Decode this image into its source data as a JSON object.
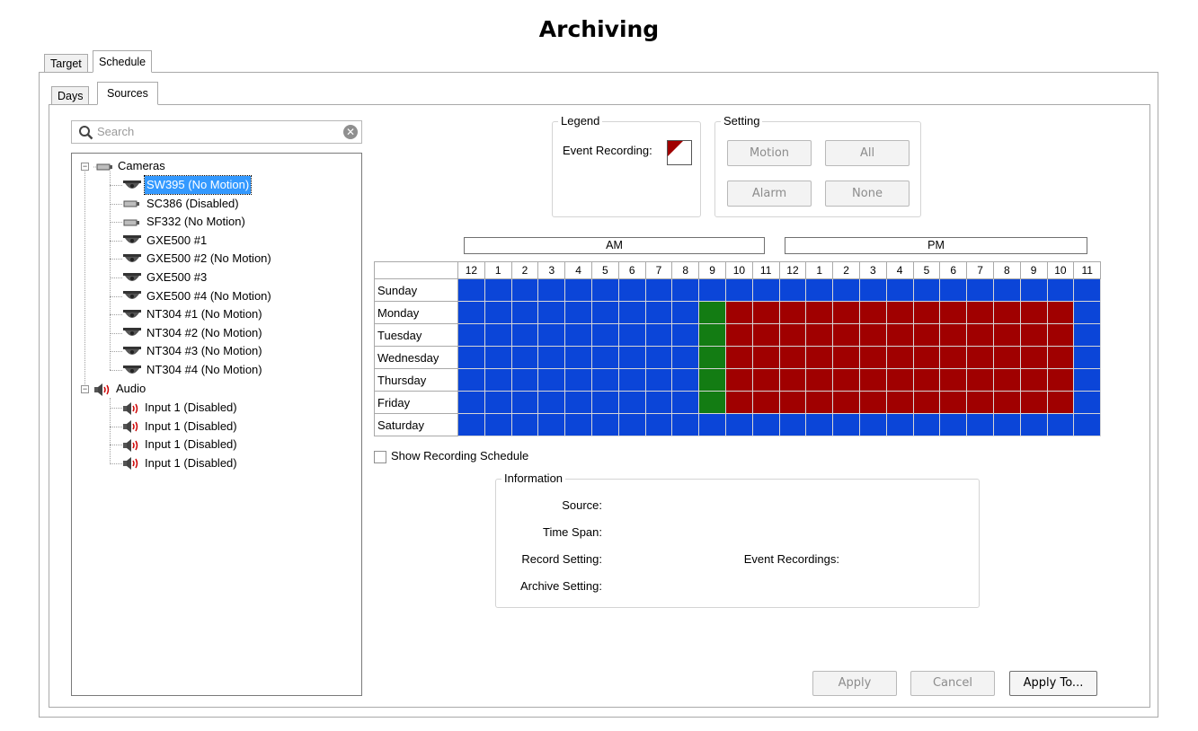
{
  "title": "Archiving",
  "tabs": {
    "outer": [
      "Target",
      "Schedule"
    ],
    "inner": [
      "Days",
      "Sources"
    ]
  },
  "search": {
    "placeholder": "Search"
  },
  "tree": {
    "cameras_label": "Cameras",
    "cameras": [
      "SW395 (No Motion)",
      "SC386 (Disabled)",
      "SF332 (No Motion)",
      "GXE500 #1",
      "GXE500 #2 (No Motion)",
      "GXE500 #3",
      "GXE500 #4 (No Motion)",
      "NT304 #1 (No Motion)",
      "NT304 #2 (No Motion)",
      "NT304 #3 (No Motion)",
      "NT304 #4 (No Motion)"
    ],
    "camera_icons": [
      "dome-camera-icon",
      "box-camera-icon",
      "box-camera-icon",
      "dome-camera-icon",
      "dome-camera-icon",
      "dome-camera-icon",
      "dome-camera-icon",
      "dome-camera-icon",
      "dome-camera-icon",
      "dome-camera-icon",
      "dome-camera-icon"
    ],
    "selected_index": 0,
    "audio_label": "Audio",
    "audio": [
      "Input 1 (Disabled)",
      "Input 1 (Disabled)",
      "Input 1 (Disabled)",
      "Input 1 (Disabled)"
    ]
  },
  "legend": {
    "title": "Legend",
    "event_recording_label": "Event Recording:"
  },
  "setting": {
    "title": "Setting",
    "motion": "Motion",
    "all": "All",
    "alarm": "Alarm",
    "none": "None"
  },
  "schedule": {
    "am_label": "AM",
    "pm_label": "PM",
    "hours": [
      "12",
      "1",
      "2",
      "3",
      "4",
      "5",
      "6",
      "7",
      "8",
      "9",
      "10",
      "11",
      "12",
      "1",
      "2",
      "3",
      "4",
      "5",
      "6",
      "7",
      "8",
      "9",
      "10",
      "11"
    ],
    "days": [
      "Sunday",
      "Monday",
      "Tuesday",
      "Wednesday",
      "Thursday",
      "Friday",
      "Saturday"
    ],
    "cells": [
      "BBBBBBBBBBBBBBBBBBBBBBBB",
      "BBBBBBBBBGRRRRRRRRRRRRRB",
      "BBBBBBBBBGRRRRRRRRRRRRRB",
      "BBBBBBBBBGRRRRRRRRRRRRRB",
      "BBBBBBBBBGRRRRRRRRRRRRRB",
      "BBBBBBBBBGRRRRRRRRRRRRRB",
      "BBBBBBBBBBBBBBBBBBBBBBBB"
    ],
    "colors": {
      "B": "#0b45d8",
      "R": "#a00000",
      "G": "#137c13"
    }
  },
  "show_recording_schedule": {
    "label": "Show Recording Schedule",
    "checked": false
  },
  "information": {
    "title": "Information",
    "source": "Source:",
    "time_span": "Time Span:",
    "record_setting": "Record Setting:",
    "event_recordings": "Event Recordings:",
    "archive_setting": "Archive Setting:"
  },
  "buttons": {
    "apply": "Apply",
    "cancel": "Cancel",
    "apply_to": "Apply To..."
  }
}
